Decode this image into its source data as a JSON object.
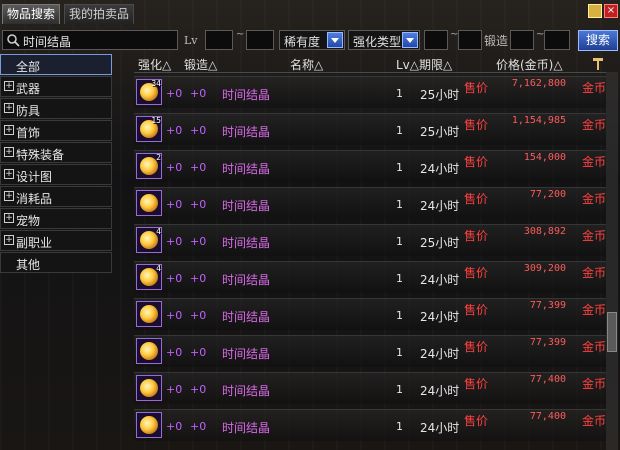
{
  "tabs": [
    {
      "label": "物品搜索",
      "active": true
    },
    {
      "label": "我的拍卖品",
      "active": false
    }
  ],
  "search": {
    "query": "时间结晶",
    "level_label": "Lv",
    "tilde": "~",
    "rarity_label": "稀有度",
    "enhance_type_label": "强化类型",
    "forge_label": "锻造",
    "search_button": "搜索"
  },
  "sidebar": {
    "items": [
      {
        "label": "全部",
        "expandable": false,
        "active": true
      },
      {
        "label": "武器",
        "expandable": true,
        "active": false
      },
      {
        "label": "防具",
        "expandable": true,
        "active": false
      },
      {
        "label": "首饰",
        "expandable": true,
        "active": false
      },
      {
        "label": "特殊装备",
        "expandable": true,
        "active": false
      },
      {
        "label": "设计图",
        "expandable": true,
        "active": false
      },
      {
        "label": "消耗品",
        "expandable": true,
        "active": false
      },
      {
        "label": "宠物",
        "expandable": true,
        "active": false
      },
      {
        "label": "副职业",
        "expandable": true,
        "active": false
      },
      {
        "label": "其他",
        "expandable": false,
        "active": false
      }
    ]
  },
  "table": {
    "headers": {
      "enhance": "强化△",
      "forge": "锻造△",
      "name": "名称△",
      "level_term": "Lv△期限△",
      "price": "价格(金币)△"
    },
    "rows": [
      {
        "count": "34",
        "enhance": "+0",
        "forge": "+0",
        "name": "时间结晶",
        "level": "1",
        "term": "25小时",
        "sale": "售价",
        "price": "7,162,800",
        "currency": "金币"
      },
      {
        "count": "15",
        "enhance": "+0",
        "forge": "+0",
        "name": "时间结晶",
        "level": "1",
        "term": "25小时",
        "sale": "售价",
        "price": "1,154,985",
        "currency": "金币"
      },
      {
        "count": "2",
        "enhance": "+0",
        "forge": "+0",
        "name": "时间结晶",
        "level": "1",
        "term": "24小时",
        "sale": "售价",
        "price": "154,000",
        "currency": "金币"
      },
      {
        "count": "",
        "enhance": "+0",
        "forge": "+0",
        "name": "时间结晶",
        "level": "1",
        "term": "24小时",
        "sale": "售价",
        "price": "77,200",
        "currency": "金币"
      },
      {
        "count": "4",
        "enhance": "+0",
        "forge": "+0",
        "name": "时间结晶",
        "level": "1",
        "term": "25小时",
        "sale": "售价",
        "price": "308,892",
        "currency": "金币"
      },
      {
        "count": "4",
        "enhance": "+0",
        "forge": "+0",
        "name": "时间结晶",
        "level": "1",
        "term": "24小时",
        "sale": "售价",
        "price": "309,200",
        "currency": "金币"
      },
      {
        "count": "",
        "enhance": "+0",
        "forge": "+0",
        "name": "时间结晶",
        "level": "1",
        "term": "24小时",
        "sale": "售价",
        "price": "77,399",
        "currency": "金币"
      },
      {
        "count": "",
        "enhance": "+0",
        "forge": "+0",
        "name": "时间结晶",
        "level": "1",
        "term": "24小时",
        "sale": "售价",
        "price": "77,399",
        "currency": "金币"
      },
      {
        "count": "",
        "enhance": "+0",
        "forge": "+0",
        "name": "时间结晶",
        "level": "1",
        "term": "24小时",
        "sale": "售价",
        "price": "77,400",
        "currency": "金币"
      },
      {
        "count": "",
        "enhance": "+0",
        "forge": "+0",
        "name": "时间结晶",
        "level": "1",
        "term": "24小时",
        "sale": "售价",
        "price": "77,400",
        "currency": "金币"
      }
    ]
  },
  "colors": {
    "item_name": "#d96ae8",
    "sale": "#ff4040",
    "accent_button": "#2f5bc4"
  }
}
